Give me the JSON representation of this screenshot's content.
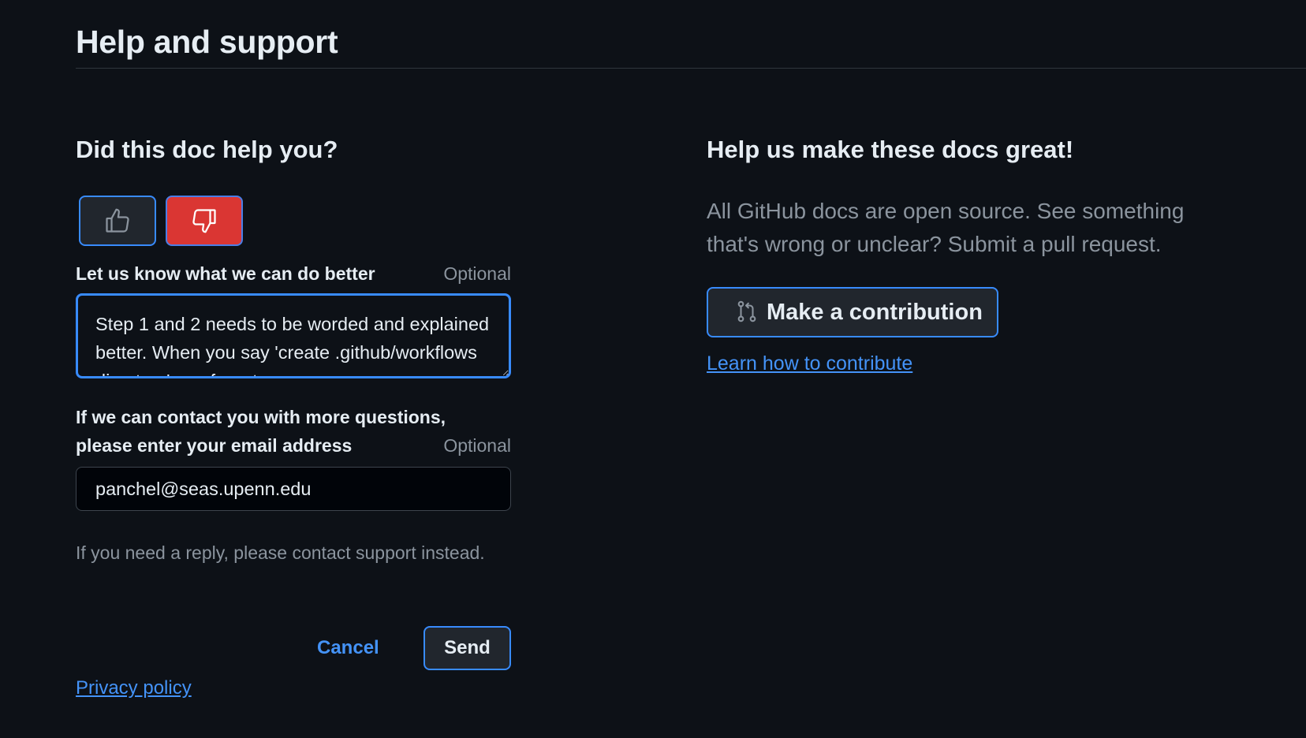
{
  "page": {
    "title": "Help and support"
  },
  "feedback": {
    "heading": "Did this doc help you?",
    "vote_up_icon": "thumbs-up-icon",
    "vote_down_icon": "thumbs-down-icon",
    "vote_selected": "down",
    "comment_label": "Let us know what we can do better",
    "comment_optional": "Optional",
    "comment_value": "Step 1 and 2 needs to be worded and explained better. When you say 'create .github/workflows directory' you forgot an",
    "email_label_line1": "If we can contact you with more questions,",
    "email_label_line2": "please enter your email address",
    "email_optional": "Optional",
    "email_value": "panchel@seas.upenn.edu",
    "support_note": "If you need a reply, please contact support instead.",
    "cancel_label": "Cancel",
    "send_label": "Send",
    "privacy_link": "Privacy policy"
  },
  "contribute": {
    "heading": "Help us make these docs great!",
    "text": "All GitHub docs are open source. See something that's wrong or unclear? Submit a pull request.",
    "button_icon": "git-pull-request-icon",
    "button_label": "Make a contribution",
    "learn_link": "Learn how to contribute"
  },
  "colors": {
    "background": "#0d1117",
    "accent": "#388bfd",
    "link": "#4493f8",
    "danger": "#da3633",
    "muted": "#8b949e"
  }
}
